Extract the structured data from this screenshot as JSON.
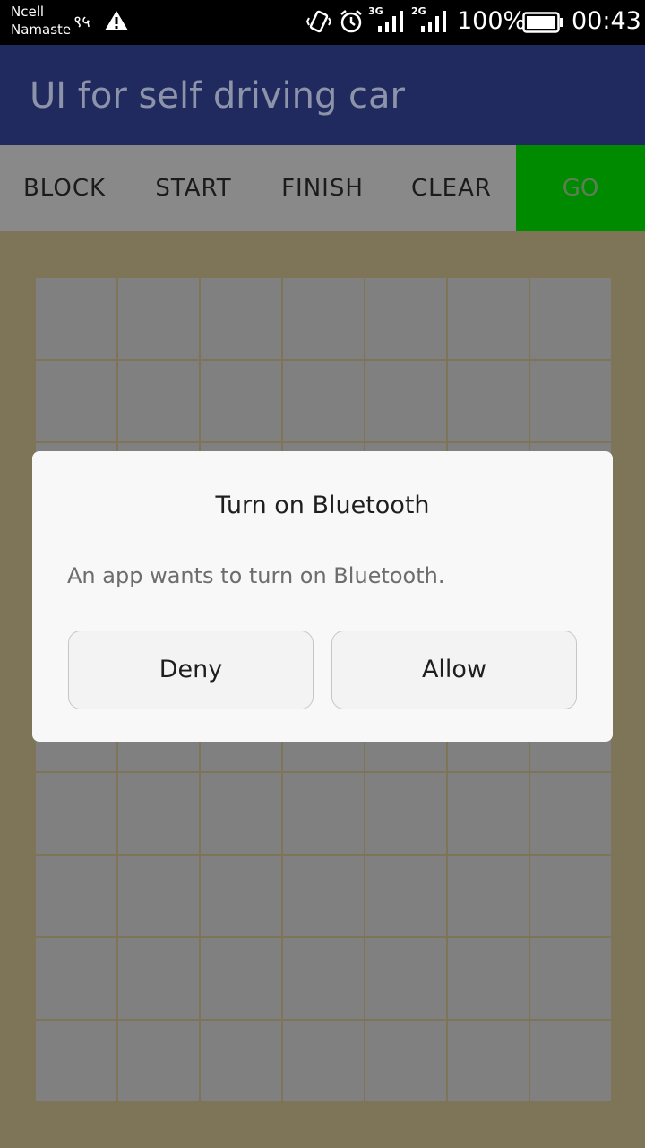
{
  "status_bar": {
    "carrier_line1": "Ncell",
    "carrier_line2": "Namaste",
    "small_glyph": "९५",
    "net1": "3G",
    "net2": "2G",
    "battery_text": "100%",
    "time": "00:43",
    "icons": [
      "warning-icon",
      "vibrate-icon",
      "alarm-icon",
      "signal-3g-icon",
      "signal-2g-icon",
      "battery-icon"
    ]
  },
  "app_bar": {
    "title": "UI for self driving car",
    "color": "#202a5f"
  },
  "toolbar": {
    "block": "BLOCK",
    "start": "START",
    "finish": "FINISH",
    "clear": "CLEAR",
    "go": "GO",
    "go_color": "#008a00"
  },
  "grid": {
    "rows": 10,
    "cols": 7
  },
  "dialog": {
    "title": "Turn on Bluetooth",
    "message": "An app wants to turn on Bluetooth.",
    "deny": "Deny",
    "allow": "Allow"
  }
}
